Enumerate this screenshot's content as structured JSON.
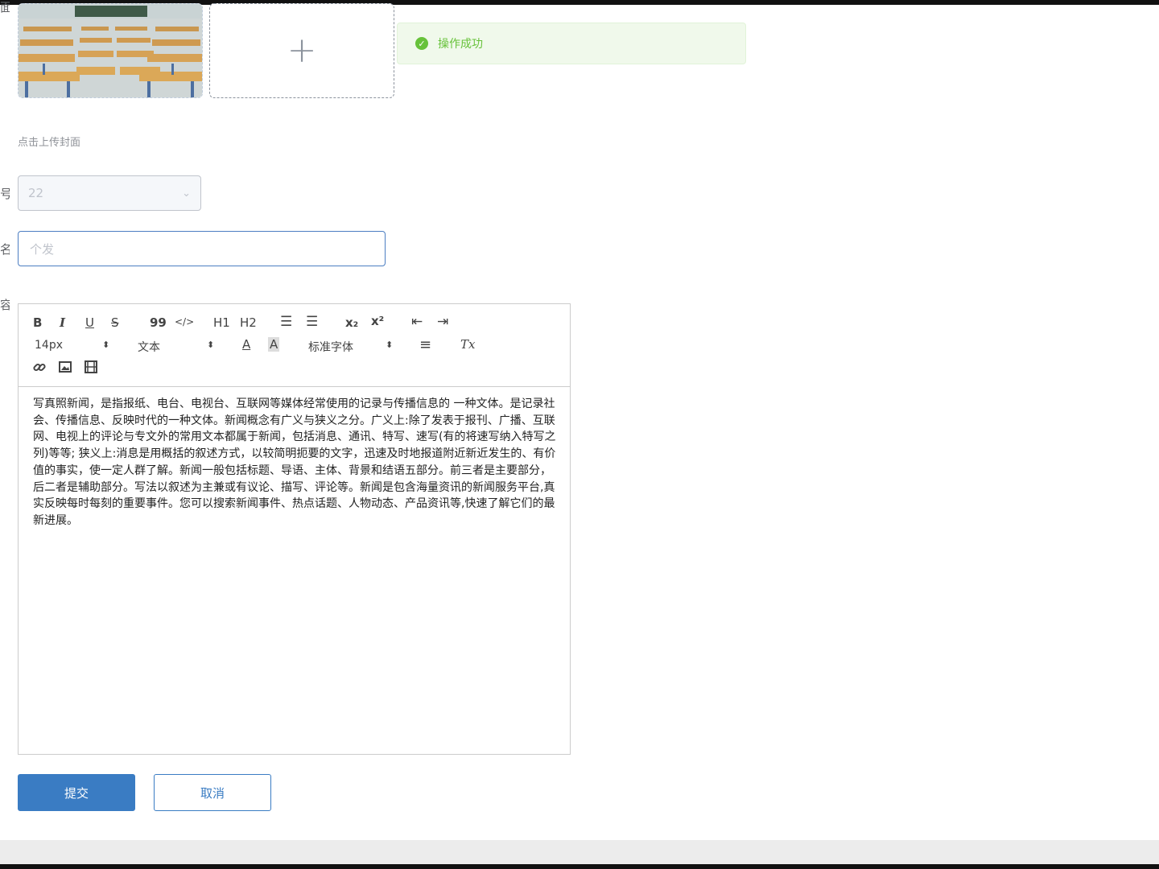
{
  "labels": {
    "cover": "面",
    "number": "号",
    "name": "名",
    "content": "容"
  },
  "upload": {
    "plus": "+",
    "hint": "点击上传封面"
  },
  "toast": {
    "icon": "check-circle-icon",
    "text": "操作成功",
    "color": "#67c23a"
  },
  "number_select": {
    "value": "22",
    "arrow": "⌄"
  },
  "name_input": {
    "placeholder": "个发"
  },
  "editor": {
    "toolbar": {
      "bold": "B",
      "italic": "I",
      "underline": "U",
      "strike": "S",
      "quote": "99",
      "code": "</>",
      "h1": "H1",
      "h2": "H2",
      "ordered_list": "☰",
      "bullet_list": "☰",
      "subscript": "x₂",
      "superscript": "x²",
      "outdent": "⇤",
      "indent": "⇥",
      "size": "14px",
      "header": "文本",
      "font": "标准字体",
      "font_color": "A",
      "background": "A",
      "align": "≡",
      "clean": "Tx",
      "updown": "⬍"
    },
    "content": "写真照新闻，是指报纸、电台、电视台、互联网等媒体经常使用的记录与传播信息的 一种文体。是记录社会、传播信息、反映时代的一种文体。新闻概念有广义与狭义之分。广义上:除了发表于报刊、广播、互联网、电视上的评论与专文外的常用文本都属于新闻，包括消息、通讯、特写、速写(有的将速写纳入特写之列)等等; 狭义上:消息是用概括的叙述方式，以较简明扼要的文字，迅速及时地报道附近新近发生的、有价值的事实，使一定人群了解。新闻一般包括标题、导语、主体、背景和结语五部分。前三者是主要部分，后二者是辅助部分。写法以叙述为主兼或有议论、描写、评论等。新闻是包含海量资讯的新闻服务平台,真实反映每时每刻的重要事件。您可以搜索新闻事件、热点话题、人物动态、产品资讯等,快速了解它们的最新进展。"
  },
  "buttons": {
    "submit": "提交",
    "cancel": "取消"
  },
  "colors": {
    "primary": "#3a7cc3",
    "success": "#67c23a"
  }
}
